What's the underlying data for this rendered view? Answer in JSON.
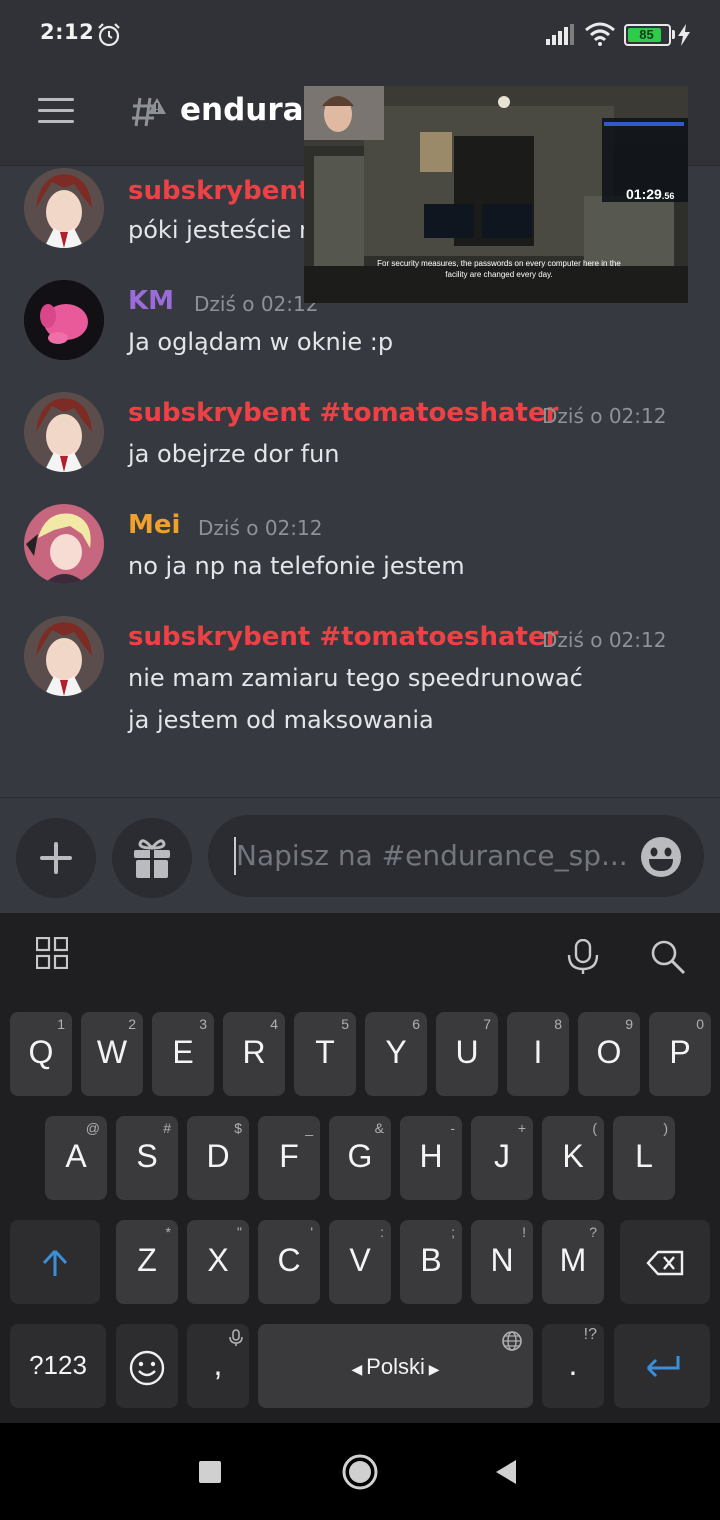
{
  "status_bar": {
    "time": "2:12",
    "battery": "85",
    "battery_level": 0.85,
    "icons": [
      "alarm-icon",
      "signal-icon",
      "wifi-icon",
      "battery-icon",
      "charging-icon"
    ]
  },
  "header": {
    "channel_name": "endurance_speedrun",
    "icons": [
      "menu-icon",
      "channel-hash-warning-icon"
    ]
  },
  "messages": [
    {
      "author": "subskrybent",
      "author_color": "#ed4245",
      "time": "",
      "lines": [
        "póki jesteście na"
      ]
    },
    {
      "author": "KM",
      "author_color": "#9b6cd9",
      "time": "Dziś o 02:12",
      "lines": [
        "Ja oglądam w oknie :p"
      ]
    },
    {
      "author": "subskrybent #tomatoeshater",
      "author_color": "#ed4245",
      "time": "Dziś o 02:12",
      "lines": [
        "ja obejrze dor fun"
      ]
    },
    {
      "author": "Mei",
      "author_color": "#f0a02c",
      "time": "Dziś o 02:12",
      "lines": [
        "no ja np na telefonie jestem"
      ]
    },
    {
      "author": "subskrybent #tomatoeshater",
      "author_color": "#ed4245",
      "time": "Dziś o 02:12",
      "lines": [
        "nie mam zamiaru tego speedrunować",
        "ja jestem od maksowania"
      ]
    }
  ],
  "pip_video": {
    "subtitle": "For security measures, the passwords on every computer here in the facility are changed every day.",
    "timer": "01:29",
    "timer_fraction": ".56"
  },
  "composer": {
    "placeholder": "Napisz na #endurance_sp...",
    "icons": [
      "plus-icon",
      "gift-icon",
      "emoji-icon"
    ]
  },
  "keyboard": {
    "toolbar_icons": [
      "grid-icon",
      "microphone-icon",
      "search-icon"
    ],
    "row1": [
      {
        "key": "Q",
        "hint": "1"
      },
      {
        "key": "W",
        "hint": "2"
      },
      {
        "key": "E",
        "hint": "3"
      },
      {
        "key": "R",
        "hint": "4"
      },
      {
        "key": "T",
        "hint": "5"
      },
      {
        "key": "Y",
        "hint": "6"
      },
      {
        "key": "U",
        "hint": "7"
      },
      {
        "key": "I",
        "hint": "8"
      },
      {
        "key": "O",
        "hint": "9"
      },
      {
        "key": "P",
        "hint": "0"
      }
    ],
    "row2": [
      {
        "key": "A",
        "hint": "@"
      },
      {
        "key": "S",
        "hint": "#"
      },
      {
        "key": "D",
        "hint": "$"
      },
      {
        "key": "F",
        "hint": "_"
      },
      {
        "key": "G",
        "hint": "&"
      },
      {
        "key": "H",
        "hint": "-"
      },
      {
        "key": "J",
        "hint": "+"
      },
      {
        "key": "K",
        "hint": "("
      },
      {
        "key": "L",
        "hint": ")"
      }
    ],
    "row3": [
      {
        "key": "Z",
        "hint": "*"
      },
      {
        "key": "X",
        "hint": "\""
      },
      {
        "key": "C",
        "hint": "'"
      },
      {
        "key": "V",
        "hint": ":"
      },
      {
        "key": "B",
        "hint": ";"
      },
      {
        "key": "N",
        "hint": "!"
      },
      {
        "key": "M",
        "hint": "?"
      }
    ],
    "symbols_key": "?123",
    "comma_key": ",",
    "space_label": "Polski",
    "period_key": ".",
    "period_hint": "!?",
    "accent_color": "#3b8fd9"
  },
  "nav_bar": {
    "icons": [
      "recents-icon",
      "home-icon",
      "back-icon"
    ]
  }
}
